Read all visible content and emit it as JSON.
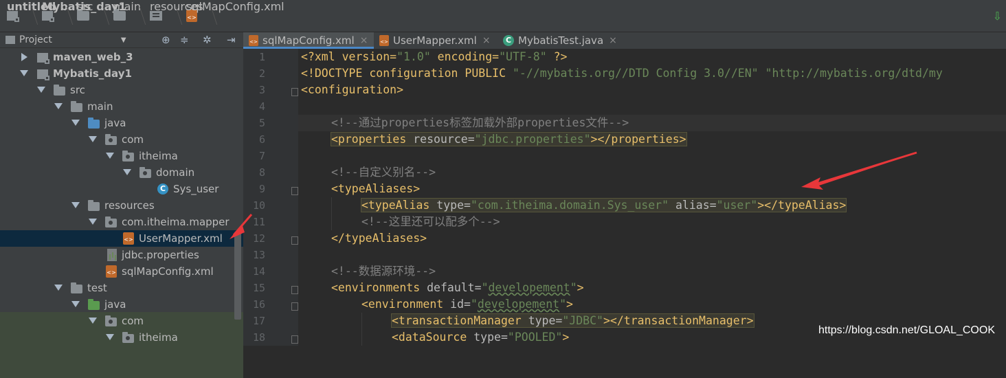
{
  "breadcrumb": [
    {
      "label": "untitled",
      "icon": "project-icon",
      "bold": true
    },
    {
      "label": "Mybatis_day1",
      "icon": "module-icon",
      "bold": true
    },
    {
      "label": "src",
      "icon": "folder-icon"
    },
    {
      "label": "main",
      "icon": "folder-icon"
    },
    {
      "label": "resources",
      "icon": "resources-folder-icon"
    },
    {
      "label": "sqlMapConfig.xml",
      "icon": "xml-file-icon"
    }
  ],
  "sidebar": {
    "header_label": "Project",
    "tree": [
      {
        "label": "maven_web_3",
        "depth": 0,
        "expanded": false,
        "icon": "module",
        "bold": true
      },
      {
        "label": "Mybatis_day1",
        "depth": 0,
        "expanded": true,
        "icon": "module",
        "bold": true
      },
      {
        "label": "src",
        "depth": 1,
        "expanded": true,
        "icon": "folder"
      },
      {
        "label": "main",
        "depth": 2,
        "expanded": true,
        "icon": "folder"
      },
      {
        "label": "java",
        "depth": 3,
        "expanded": true,
        "icon": "folder-blue"
      },
      {
        "label": "com",
        "depth": 4,
        "expanded": true,
        "icon": "package"
      },
      {
        "label": "itheima",
        "depth": 5,
        "expanded": true,
        "icon": "package"
      },
      {
        "label": "domain",
        "depth": 6,
        "expanded": true,
        "icon": "package"
      },
      {
        "label": "Sys_user",
        "depth": 7,
        "icon": "class"
      },
      {
        "label": "resources",
        "depth": 3,
        "expanded": true,
        "icon": "resources"
      },
      {
        "label": "com.itheima.mapper",
        "depth": 4,
        "expanded": true,
        "icon": "package"
      },
      {
        "label": "UserMapper.xml",
        "depth": 5,
        "icon": "xml",
        "selected": true
      },
      {
        "label": "jdbc.properties",
        "depth": 4,
        "icon": "properties"
      },
      {
        "label": "sqlMapConfig.xml",
        "depth": 4,
        "icon": "xml"
      },
      {
        "label": "test",
        "depth": 2,
        "expanded": true,
        "icon": "folder"
      },
      {
        "label": "java",
        "depth": 3,
        "expanded": true,
        "icon": "folder-green"
      },
      {
        "label": "com",
        "depth": 4,
        "expanded": true,
        "icon": "package"
      },
      {
        "label": "itheima",
        "depth": 5,
        "expanded": true,
        "icon": "package"
      }
    ]
  },
  "tabs": [
    {
      "label": "sqlMapConfig.xml",
      "active": true,
      "icon": "xml-file-icon"
    },
    {
      "label": "UserMapper.xml",
      "active": false,
      "icon": "xml-file-icon"
    },
    {
      "label": "MybatisTest.java",
      "active": false,
      "icon": "java-class-icon"
    }
  ],
  "editor": {
    "line_numbers": [
      "1",
      "2",
      "3",
      "4",
      "5",
      "6",
      "7",
      "8",
      "9",
      "10",
      "11",
      "12",
      "13",
      "14",
      "15",
      "16",
      "17",
      "18"
    ],
    "lines": {
      "l1": {
        "a": "<?xml version=",
        "b": "\"1.0\"",
        "c": " encoding=",
        "d": "\"UTF-8\"",
        "e": " ?>"
      },
      "l2": {
        "a": "<!DOCTYPE configuration PUBLIC ",
        "b": "\"-//mybatis.org//DTD Config 3.0//EN\" \"http://mybatis.org/dtd/my"
      },
      "l3": {
        "a": "<configuration>"
      },
      "l5": {
        "a": "<!--通过properties标签加载外部properties文件-->"
      },
      "l6": {
        "a": "<properties ",
        "b": "resource=",
        "c": "\"jdbc.properties\"",
        "d": "></properties>"
      },
      "l8": {
        "a": "<!--自定义别名-->"
      },
      "l9": {
        "a": "<typeAliases>"
      },
      "l10": {
        "a": "<typeAlias ",
        "b": "type=",
        "c": "\"com.itheima.domain.Sys_user\"",
        "d": " alias=",
        "e": "\"user\"",
        "f": "></typeAlias>"
      },
      "l11": {
        "a": "<!--这里还可以配多个-->"
      },
      "l12": {
        "a": "</typeAliases>"
      },
      "l14": {
        "a": "<!--数据源环境-->"
      },
      "l15": {
        "a": "<environments ",
        "b": "default=",
        "c": "\"",
        "d": "developement",
        "e": "\"",
        "f": ">"
      },
      "l16": {
        "a": "<environment ",
        "b": "id=",
        "c": "\"",
        "d": "developement",
        "e": "\"",
        "f": ">"
      },
      "l17": {
        "a": "<transactionManager ",
        "b": "type=",
        "c": "\"JDBC\"",
        "d": "></transactionManager>"
      },
      "l18": {
        "a": "<dataSource ",
        "b": "type=",
        "c": "\"POOLED\"",
        "d": ">"
      }
    }
  },
  "watermark": "https://blog.csdn.net/GLOAL_COOK",
  "colors": {
    "tag": "#e8bf6a",
    "attr_value": "#6a8759",
    "comment": "#808080",
    "annotation_arrow": "#e8373a"
  }
}
